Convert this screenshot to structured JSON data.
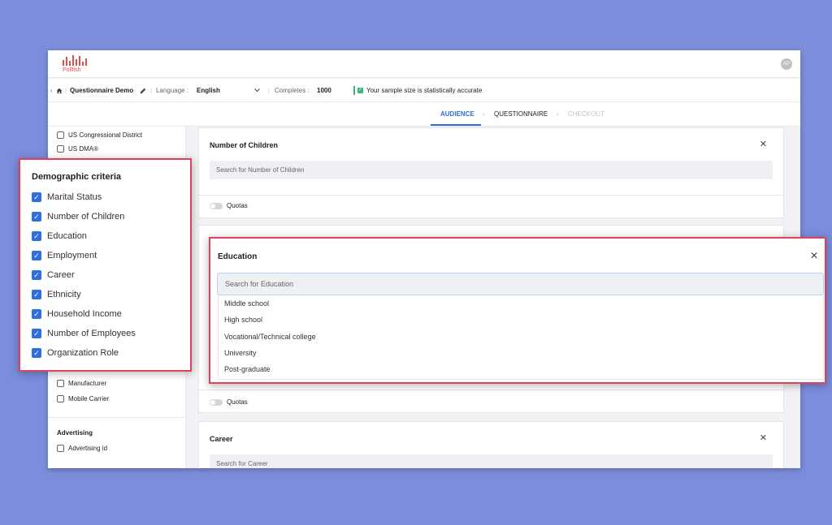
{
  "brand": {
    "name": "Pollfish",
    "color": "#e24b4b"
  },
  "user": {
    "initials": "AP"
  },
  "toolbar": {
    "home_icon": "home-icon",
    "title": "Questionnaire Demo",
    "language_label": "Language :",
    "language_value": "English",
    "completes_label": "Completes :",
    "completes_value": "1000",
    "status_text": "Your sample size is statistically accurate"
  },
  "steps": [
    {
      "label": "AUDIENCE",
      "state": "active"
    },
    {
      "label": "QUESTIONNAIRE",
      "state": "default"
    },
    {
      "label": "CHECKOUT",
      "state": "disabled"
    }
  ],
  "sidebar": {
    "top_items": [
      "US Congressional District",
      "US DMA®"
    ],
    "bottom_items": [
      "Manufacturer",
      "Mobile Carrier"
    ],
    "advertising_heading": "Advertising",
    "advertising_items": [
      "Advertising id"
    ]
  },
  "demographics": {
    "heading": "Demographic criteria",
    "items": [
      "Marital Status",
      "Number of Children",
      "Education",
      "Employment",
      "Career",
      "Ethnicity",
      "Household Income",
      "Number of Employees",
      "Organization Role"
    ]
  },
  "cards": {
    "children": {
      "title": "Number of Children",
      "placeholder": "Search for Number of Children",
      "quotas": "Quotas"
    },
    "education_quotas": "Quotas",
    "career": {
      "title": "Career",
      "placeholder": "Search for Career"
    }
  },
  "education_popup": {
    "title": "Education",
    "placeholder": "Search for Education",
    "options": [
      "Middle school",
      "High school",
      "Vocational/Technical college",
      "University",
      "Post-graduate"
    ]
  },
  "colors": {
    "accent": "#2f6fe0",
    "highlight": "#e0425e",
    "success": "#31b87a",
    "background": "#7b8ddb"
  }
}
